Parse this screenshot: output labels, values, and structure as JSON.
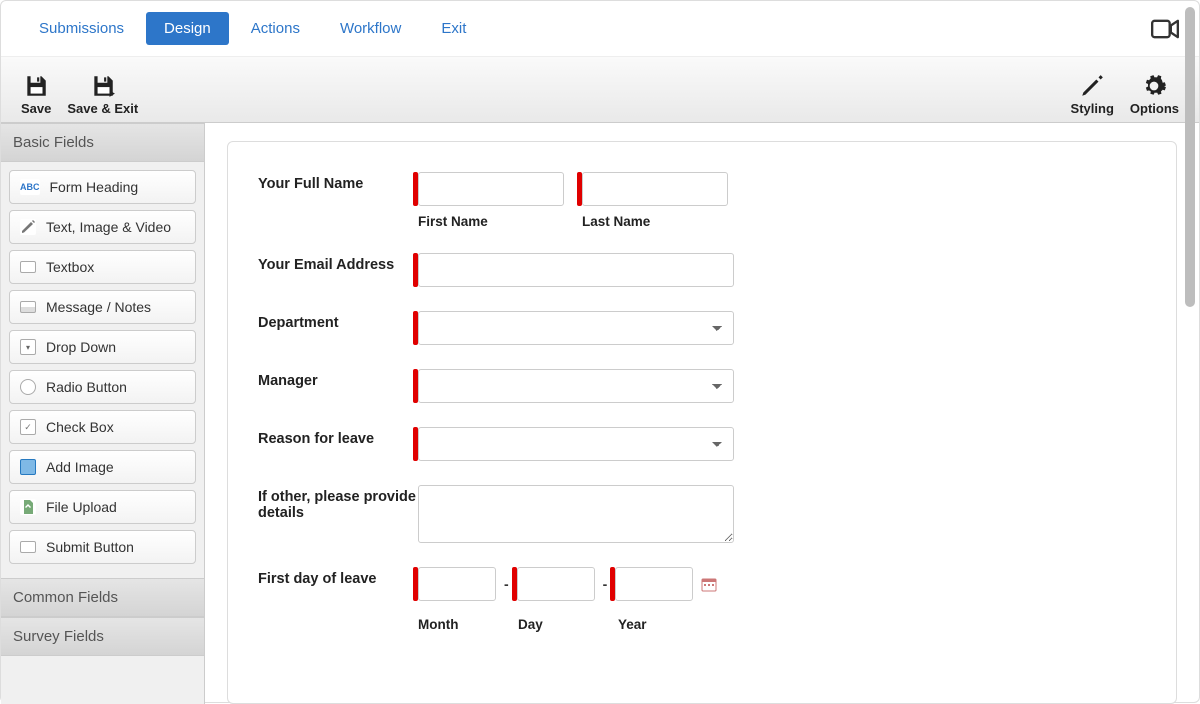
{
  "tabs": {
    "submissions": "Submissions",
    "design": "Design",
    "actions": "Actions",
    "workflow": "Workflow",
    "exit": "Exit"
  },
  "toolbar": {
    "save": "Save",
    "save_exit": "Save & Exit",
    "styling": "Styling",
    "options": "Options"
  },
  "sidebar": {
    "basic_header": "Basic Fields",
    "common_header": "Common Fields",
    "survey_header": "Survey Fields",
    "items": [
      {
        "label": "Form Heading",
        "icon_text": "ABC"
      },
      {
        "label": "Text, Image & Video",
        "icon_text": ""
      },
      {
        "label": "Textbox",
        "icon_text": ""
      },
      {
        "label": "Message / Notes",
        "icon_text": ""
      },
      {
        "label": "Drop Down",
        "icon_text": ""
      },
      {
        "label": "Radio Button",
        "icon_text": ""
      },
      {
        "label": "Check Box",
        "icon_text": ""
      },
      {
        "label": "Add Image",
        "icon_text": ""
      },
      {
        "label": "File Upload",
        "icon_text": ""
      },
      {
        "label": "Submit Button",
        "icon_text": ""
      }
    ]
  },
  "form": {
    "full_name": {
      "label": "Your Full Name",
      "first_sub": "First Name",
      "last_sub": "Last Name"
    },
    "email": {
      "label": "Your Email Address"
    },
    "department": {
      "label": "Department"
    },
    "manager": {
      "label": "Manager"
    },
    "reason": {
      "label": "Reason for leave"
    },
    "other": {
      "label": "If other, please provide details"
    },
    "first_day": {
      "label": "First day of leave",
      "month_sub": "Month",
      "day_sub": "Day",
      "year_sub": "Year",
      "sep": "-"
    }
  }
}
